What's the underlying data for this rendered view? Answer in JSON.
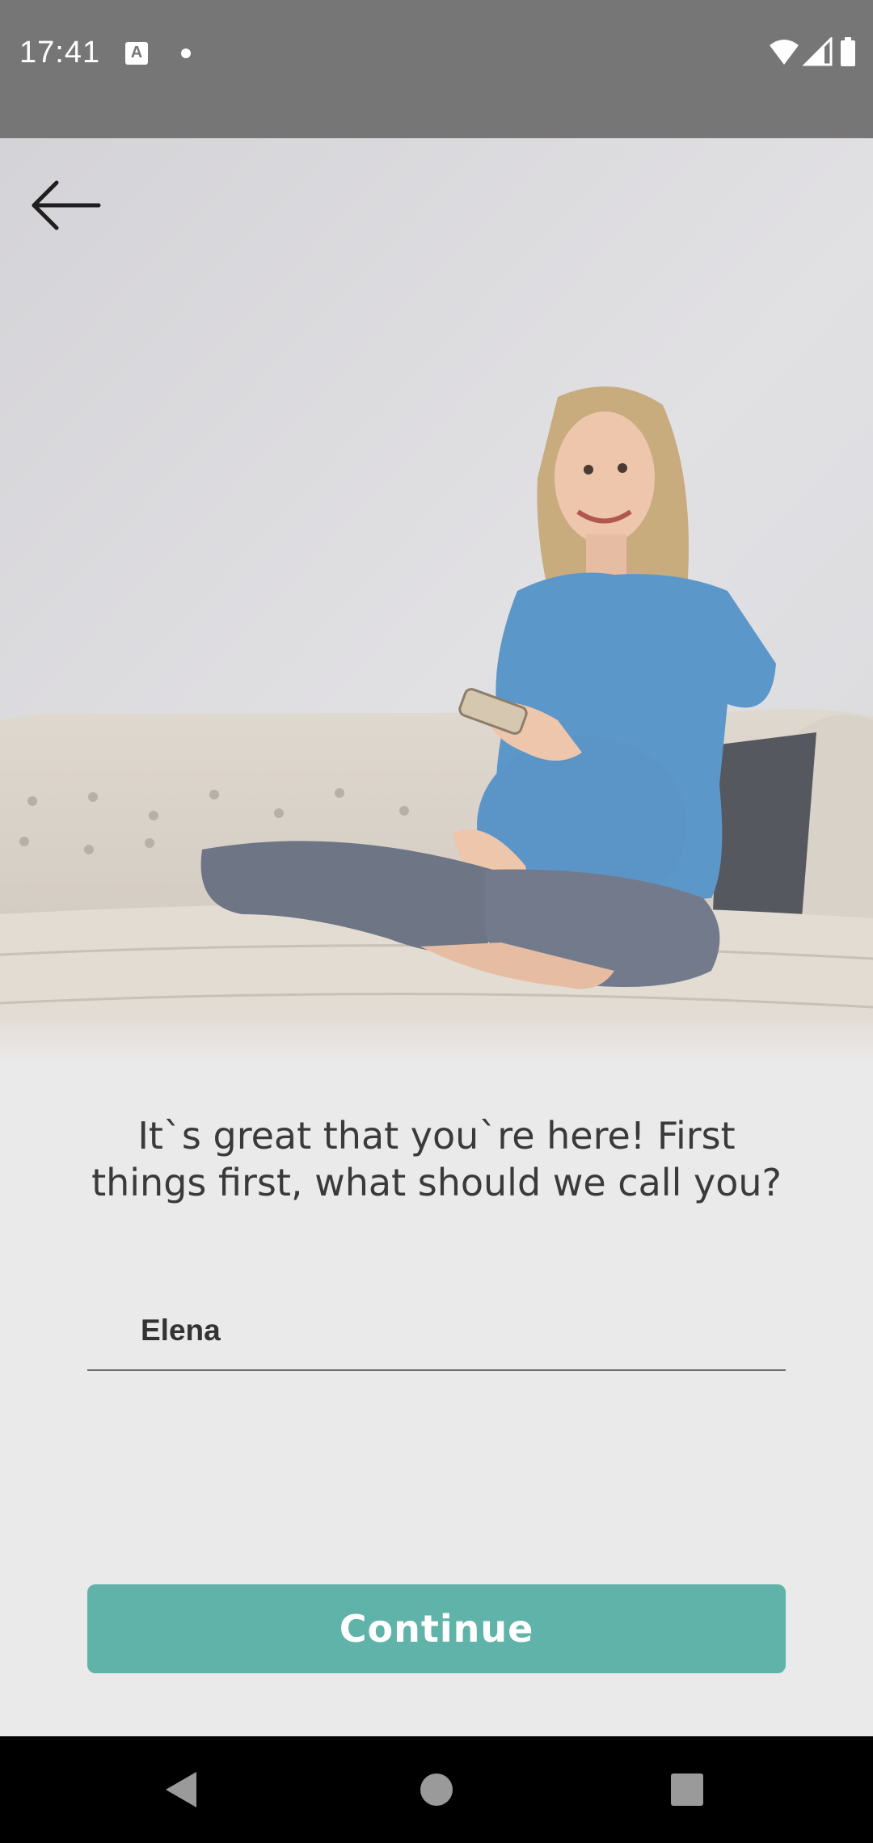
{
  "status_bar": {
    "time": "17:41",
    "icons": [
      "a-notification-icon",
      "dot-icon",
      "wifi-icon",
      "signal-icon",
      "battery-icon"
    ]
  },
  "header": {
    "back_icon": "arrow-left-icon"
  },
  "hero": {
    "image_semantic": "pregnant woman sitting on sofa holding phone"
  },
  "onboarding": {
    "title": "It`s great that you`re here! First things first, what should we call you?",
    "name_input": {
      "value": "Elena",
      "placeholder": ""
    },
    "continue_label": "Continue"
  },
  "colors": {
    "accent": "#60b3a9",
    "background": "#ebeaeb",
    "status_bar": "#767676",
    "nav_bar": "#000000"
  },
  "nav_bar": {
    "buttons": [
      "back-triangle-icon",
      "home-circle-icon",
      "recents-square-icon"
    ]
  }
}
